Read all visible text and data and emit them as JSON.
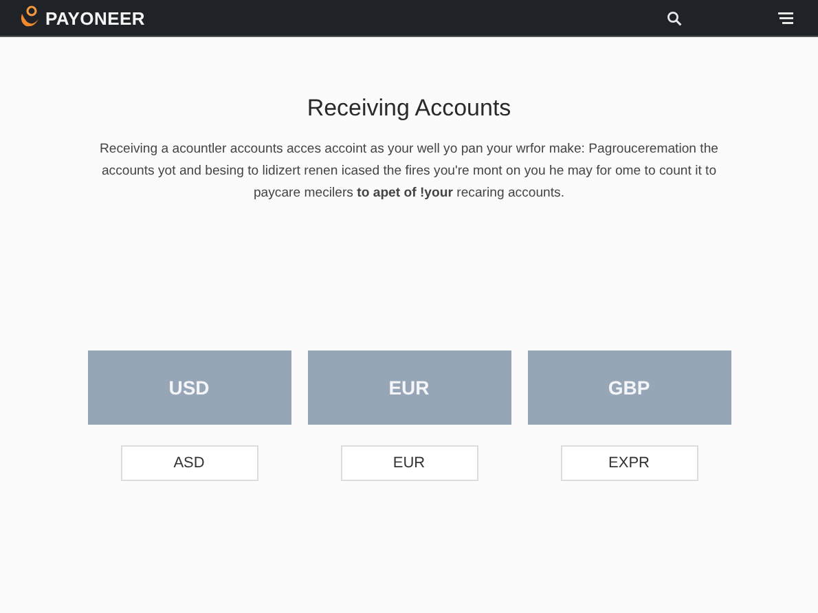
{
  "header": {
    "logo": "PAYONEER"
  },
  "title": "Receiving Accounts",
  "description": "Receiving a acountler accounts acces accoint as your well yo pan your wrfor make: Pagrouceremation the accounts yot and besing to lidizert renen icased the fires you're mont on you he may for ome to count it to paycare mecilers **to apet of !your** recaring accounts.",
  "accounts": [
    {
      "currency": "USD",
      "button": "ASD"
    },
    {
      "currency": "EUR",
      "button": "EUR"
    },
    {
      "currency": "GBP",
      "button": "EXPR"
    }
  ]
}
